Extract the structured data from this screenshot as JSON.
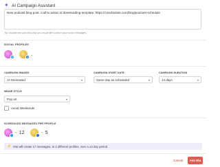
{
  "header": {
    "title": "AI Campaign Assistant",
    "icon": "sparkle-icon"
  },
  "prompt": {
    "value": "New podcast blog post. Call to action is downloading template. https://coschedule.com/blog/podcast-schedule",
    "tip": "Tip: Include text and links that you would like used in your social messages."
  },
  "social_profiles": {
    "label": "SOCIAL PROFILES"
  },
  "campaign_images": {
    "label": "CAMPAIGN IMAGES",
    "value": "AI Generated"
  },
  "campaign_start": {
    "label": "CAMPAIGN START DATE",
    "value": "Same day as scheduled"
  },
  "campaign_duration": {
    "label": "CAMPAIGN DURATION",
    "value": "14 days"
  },
  "image_style": {
    "label": "IMAGE STYLE",
    "value": "Pop art"
  },
  "avoid_weekends": {
    "label": "Avoid Weekends",
    "checked": false
  },
  "scheduled_messages": {
    "label": "SCHEDULED MESSAGES PER PROFILE",
    "profiles": [
      {
        "count": "12",
        "icon": "twitter-icon"
      },
      {
        "count": "5",
        "icon": "facebook-icon"
      }
    ]
  },
  "info": {
    "message": "Mia will create 17 messages, to 2 different profiles, over a 14 day period."
  },
  "buttons": {
    "cancel": "Cancel",
    "ask": "Ask Mia"
  },
  "colors": {
    "accent": "#6a4fe0",
    "primary_button": "#e05a4e",
    "info_bg": "#eeeefa"
  }
}
